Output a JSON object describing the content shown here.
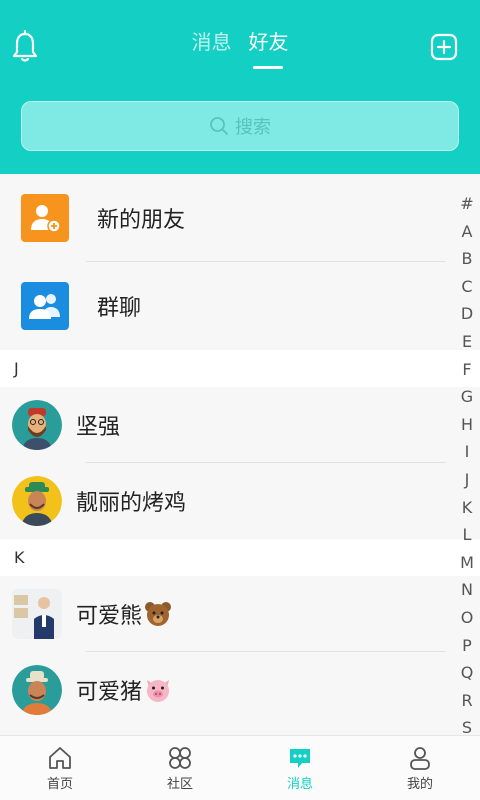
{
  "header": {
    "tabs": [
      {
        "label": "消息",
        "active": false
      },
      {
        "label": "好友",
        "active": true
      }
    ],
    "bell_icon": "bell-icon",
    "add_icon": "plus-square-icon",
    "accent_color": "#13cfc4"
  },
  "search": {
    "placeholder": "搜索",
    "icon": "search-icon"
  },
  "top_items": [
    {
      "label": "新的朋友",
      "icon": "add-friend-icon",
      "color": "#f7941d"
    },
    {
      "label": "群聊",
      "icon": "group-chat-icon",
      "color": "#1a8de0"
    }
  ],
  "sections": [
    {
      "letter": "J",
      "contacts": [
        {
          "name": "坚强"
        },
        {
          "name": "靓丽的烤鸡"
        }
      ]
    },
    {
      "letter": "K",
      "contacts": [
        {
          "name": "可爱熊",
          "emoji": "bear-face-icon"
        },
        {
          "name": "可爱猪",
          "emoji": "pig-face-icon"
        }
      ]
    }
  ],
  "alpha_index": [
    "#",
    "A",
    "B",
    "C",
    "D",
    "E",
    "F",
    "G",
    "H",
    "I",
    "J",
    "K",
    "L",
    "M",
    "N",
    "O",
    "P",
    "Q",
    "R",
    "S"
  ],
  "bottom_nav": [
    {
      "label": "首页",
      "icon": "home-icon",
      "active": false
    },
    {
      "label": "社区",
      "icon": "community-icon",
      "active": false
    },
    {
      "label": "消息",
      "icon": "chat-bubble-icon",
      "active": true
    },
    {
      "label": "我的",
      "icon": "profile-icon",
      "active": false
    }
  ]
}
